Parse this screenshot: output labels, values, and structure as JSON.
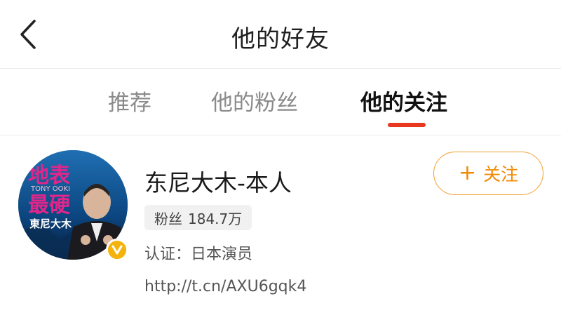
{
  "header": {
    "title": "他的好友",
    "back_icon": "chevron-left-icon"
  },
  "tabs": [
    {
      "label": "推荐",
      "active": false
    },
    {
      "label": "他的粉丝",
      "active": false
    },
    {
      "label": "他的关注",
      "active": true
    }
  ],
  "colors": {
    "accent": "#e8381f",
    "follow": "#f08a00",
    "verified": "#f4b20c"
  },
  "user": {
    "name": "东尼大木-本人",
    "fans_label": "粉丝",
    "fans_count": "184.7万",
    "verification": "认证：日本演员",
    "link": "http://t.cn/AXU6gqk4",
    "follow_label": "关注",
    "follow_icon": "plus-icon",
    "verified_icon": "verified-v-icon",
    "avatar_text": {
      "line1": "地表",
      "line2": "最硬",
      "en": "TONY OOKI",
      "jp": "東尼大木"
    }
  }
}
